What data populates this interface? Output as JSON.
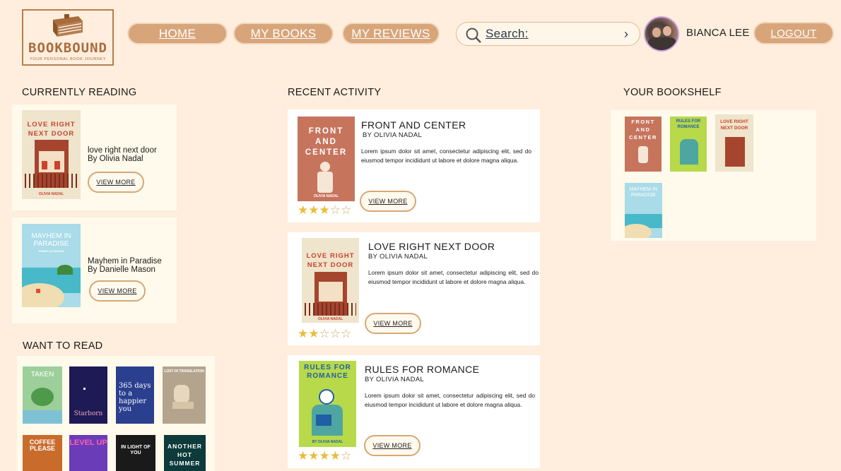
{
  "brand": {
    "name": "BOOKBOUND",
    "tagline": "YOUR PERSONAL BOOK JOURNEY"
  },
  "nav": [
    {
      "label": "HOME"
    },
    {
      "label": "MY BOOKS"
    },
    {
      "label": "MY REVIEWS"
    }
  ],
  "search": {
    "label": "Search:"
  },
  "user": {
    "name": "BIANCA LEE"
  },
  "logout": {
    "label": "LOGOUT"
  },
  "currently_reading": {
    "title": "CURRENTLY READING",
    "items": [
      {
        "title": "love right next door",
        "author": "By Olivia Nadal",
        "button": "VIEW MORE"
      },
      {
        "title": "Mayhem in Paradise",
        "author": "By Danielle Mason",
        "button": "VIEW MORE"
      }
    ]
  },
  "want_to_read": {
    "title": "WANT TO READ",
    "covers": [
      "TAKEN",
      "Starborn",
      "365 days to a happier you",
      "LOST IN TRANSLATION",
      "COFFEE PLEASE",
      "LEVEL UP",
      "IN LIGHT OF YOU",
      "ANOTHER HOT SUMMER"
    ]
  },
  "recent_activity": {
    "title": "RECENT ACTIVITY",
    "items": [
      {
        "title": "FRONT AND CENTER",
        "author": "BY OLIVIA NADAL",
        "desc": "Lorem ipsum dolor sit amet, consectetur adipiscing elit, sed do eiusmod tempor incididunt ut labore et dolore magna aliqua.",
        "button": "VIEW MORE",
        "rating": 3,
        "max_rating": 5
      },
      {
        "title": "LOVE RIGHT NEXT DOOR",
        "author": "BY OLIVIA NADAL",
        "desc": "Lorem ipsum dolor sit amet, consectetur adipiscing elit, sed do eiusmod tempor incididunt ut labore et dolore magna aliqua.",
        "button": "VIEW MORE",
        "rating": 2,
        "max_rating": 5
      },
      {
        "title": "RULES FOR ROMANCE",
        "author": "BY OLIVIA NADAL",
        "desc": "Lorem ipsum dolor sit amet, consectetur adipiscing elit, sed do eiusmod tempor incididunt ut labore et dolore magna aliqua.",
        "button": "VIEW MORE",
        "rating": 4,
        "max_rating": 5
      }
    ]
  },
  "bookshelf": {
    "title": "YOUR BOOKSHELF",
    "covers": [
      "FRONT AND CENTER",
      "RULES FOR ROMANCE",
      "LOVE RIGHT NEXT DOOR",
      "MAYHEM IN PARADISE"
    ]
  },
  "cover_text": {
    "front_and_center": "FRONT AND CENTER",
    "love_right_next_door": "LOVE RIGHT NEXT DOOR",
    "rules_for_romance": "RULES FOR ROMANCE",
    "mayhem_in_paradise": "MAYHEM IN PARADISE",
    "olivia_nadal": "OLIVIA NADAL",
    "danielle_mason": "DANIELLE MASON",
    "by_olivia_nadal": "BY OLIVIA NADAL"
  },
  "colors": {
    "background": "#ffeedd",
    "nav_button": "#d8a57a",
    "accent": "#a96c3d",
    "card": "#fffaeb",
    "star": "#e8bd3c"
  }
}
